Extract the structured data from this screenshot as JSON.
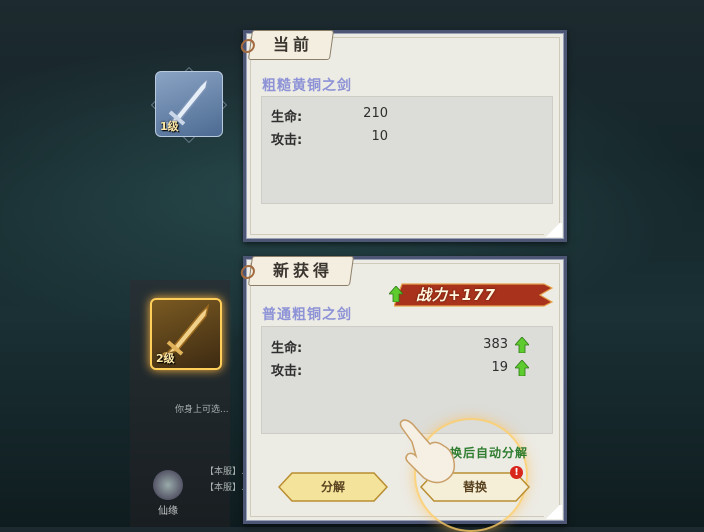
{
  "current": {
    "tag": "当前",
    "item_name": "粗糙黄铜之剑",
    "level": "1级",
    "stats": [
      {
        "label": "生命:",
        "value": "210"
      },
      {
        "label": "攻击:",
        "value": "10"
      }
    ]
  },
  "new_item": {
    "tag": "新获得",
    "item_name": "普通粗铜之剑",
    "level": "2级",
    "power": "战力+177",
    "stats": [
      {
        "label": "生命:",
        "value": "383"
      },
      {
        "label": "攻击:",
        "value": "19"
      }
    ],
    "auto_note": "换后自动分解",
    "decompose_label": "分解",
    "replace_label": "替换",
    "alert_mark": "!"
  },
  "background": {
    "xianyuan_label": "仙缘",
    "chat_lines": [
      "你身上可选...",
      "【本服】...",
      "【本服】..."
    ]
  },
  "colors": {
    "item_name": "#8d93d6",
    "panel_border": "#4d5674",
    "power_banner": "#a8321c",
    "stat_up_arrow": "#5ecb2f",
    "auto_note": "#2f7d2f"
  },
  "icons": {
    "stat_up": "green-up-arrow-icon",
    "power_up": "green-up-arrow-icon",
    "tutorial": "pointing-hand-icon"
  }
}
